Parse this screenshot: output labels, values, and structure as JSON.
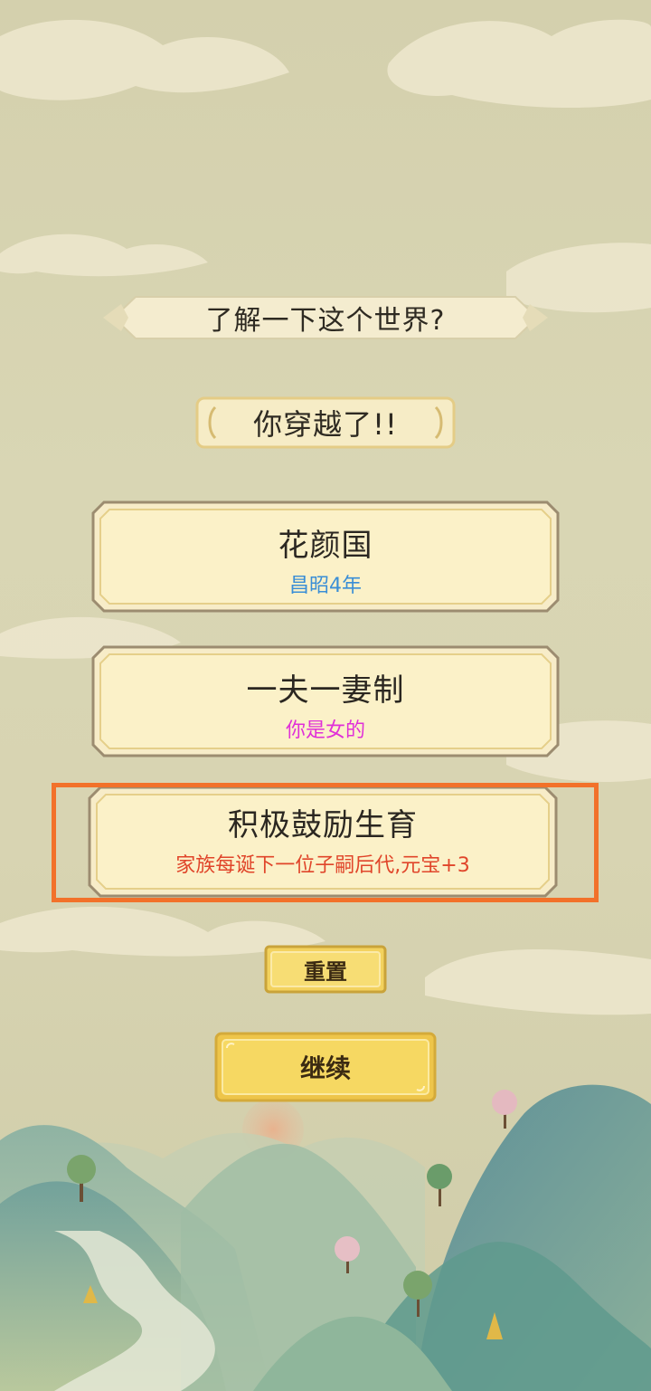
{
  "title_banner": "了解一下这个世界?",
  "sub_banner": "你穿越了!!",
  "cards": [
    {
      "main": "花颜国",
      "sub": "昌昭4年",
      "sub_color": "#3a8ed6"
    },
    {
      "main": "一夫一妻制",
      "sub": "你是女的",
      "sub_color": "#e030d8"
    },
    {
      "main": "积极鼓励生育",
      "sub": "家族每诞下一位子嗣后代,元宝+3",
      "sub_color": "#e0452a"
    }
  ],
  "buttons": {
    "reset": "重置",
    "continue": "继续"
  },
  "colors": {
    "highlight": "#f2712a",
    "card_fill": "#fbf1c8",
    "gold": "#f4d463"
  }
}
